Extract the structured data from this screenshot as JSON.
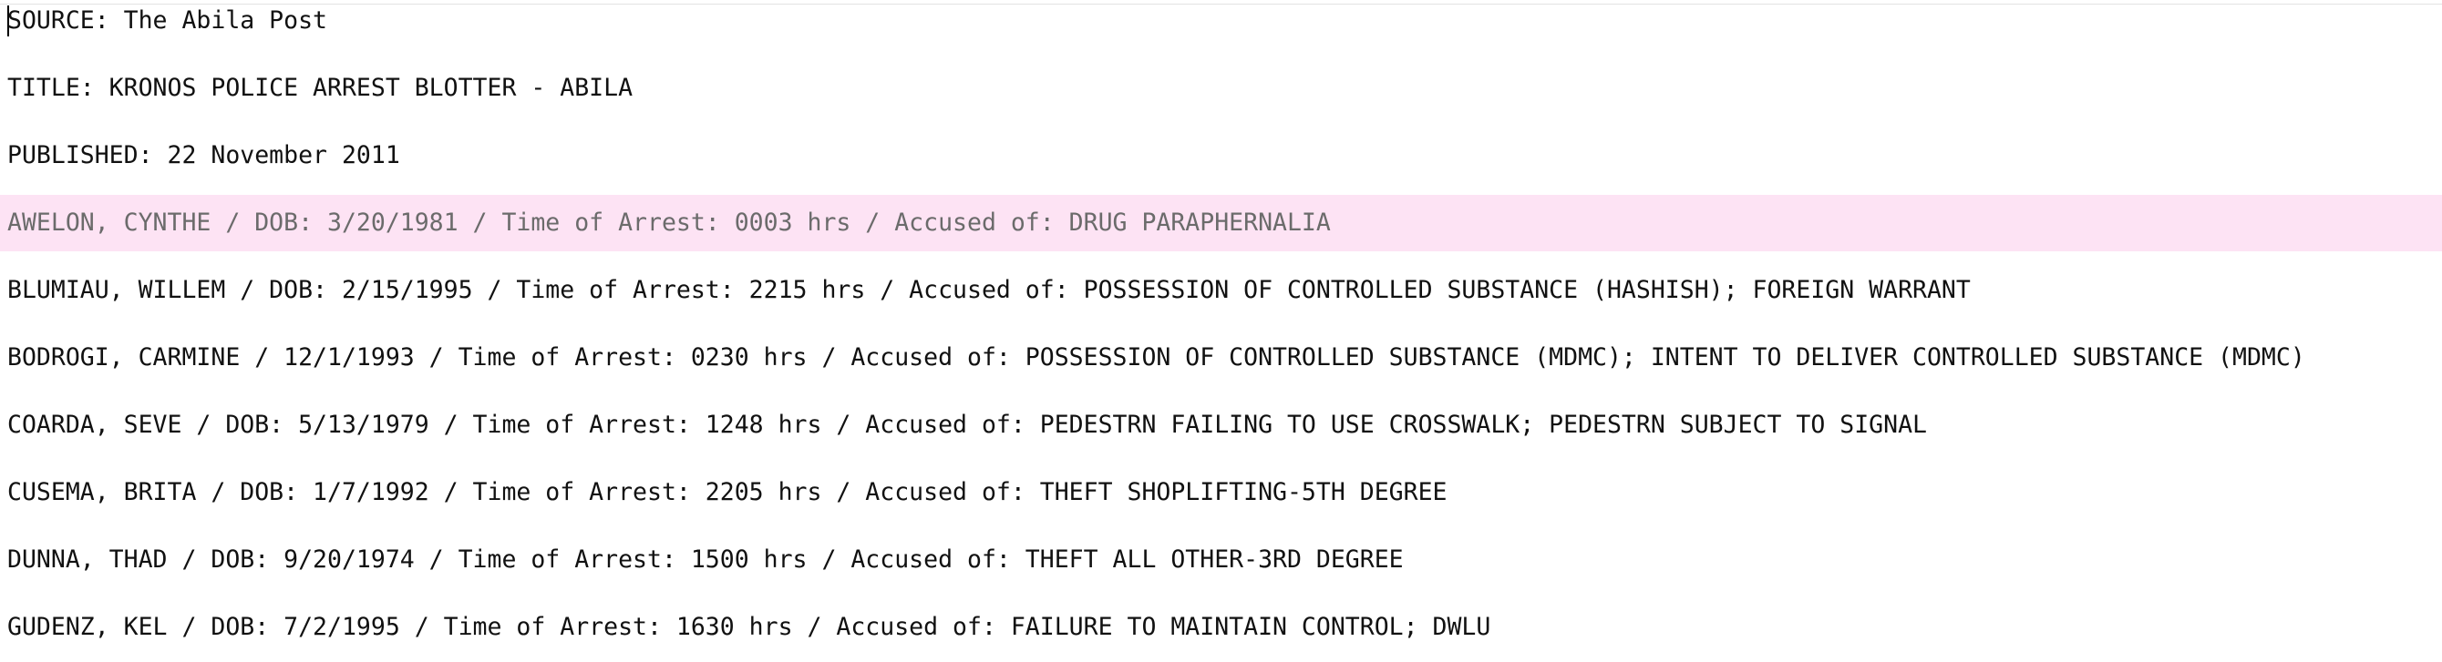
{
  "document": {
    "header": {
      "source": "SOURCE: The Abila Post",
      "title": "TITLE: KRONOS POLICE ARREST BLOTTER - ABILA",
      "published": "PUBLISHED: 22 November 2011"
    },
    "entries": [
      "AWELON, CYNTHE / DOB: 3/20/1981 / Time of Arrest: 0003 hrs / Accused of: DRUG PARAPHERNALIA",
      "BLUMIAU, WILLEM / DOB: 2/15/1995 / Time of Arrest: 2215 hrs / Accused of: POSSESSION OF CONTROLLED SUBSTANCE (HASHISH); FOREIGN WARRANT",
      "BODROGI, CARMINE / 12/1/1993 / Time of Arrest: 0230 hrs / Accused of: POSSESSION OF CONTROLLED SUBSTANCE (MDMC); INTENT TO DELIVER CONTROLLED SUBSTANCE (MDMC)",
      "COARDA, SEVE / DOB: 5/13/1979 / Time of Arrest: 1248 hrs / Accused of: PEDESTRN FAILING TO USE CROSSWALK; PEDESTRN SUBJECT TO SIGNAL",
      "CUSEMA, BRITA / DOB: 1/7/1992 / Time of Arrest: 2205 hrs / Accused of: THEFT SHOPLIFTING-5TH DEGREE",
      "DUNNA, THAD / DOB: 9/20/1974 / Time of Arrest: 1500 hrs / Accused of: THEFT ALL OTHER-3RD DEGREE",
      "GUDENZ, KEL / DOB: 7/2/1995 / Time of Arrest: 1630 hrs / Accused of: FAILURE TO MAINTAIN CONTROL; DWLU"
    ]
  },
  "colors": {
    "highlight_background": "#fde3f4",
    "highlight_text": "#6b6b6b",
    "text": "#111111",
    "background": "#ffffff"
  }
}
